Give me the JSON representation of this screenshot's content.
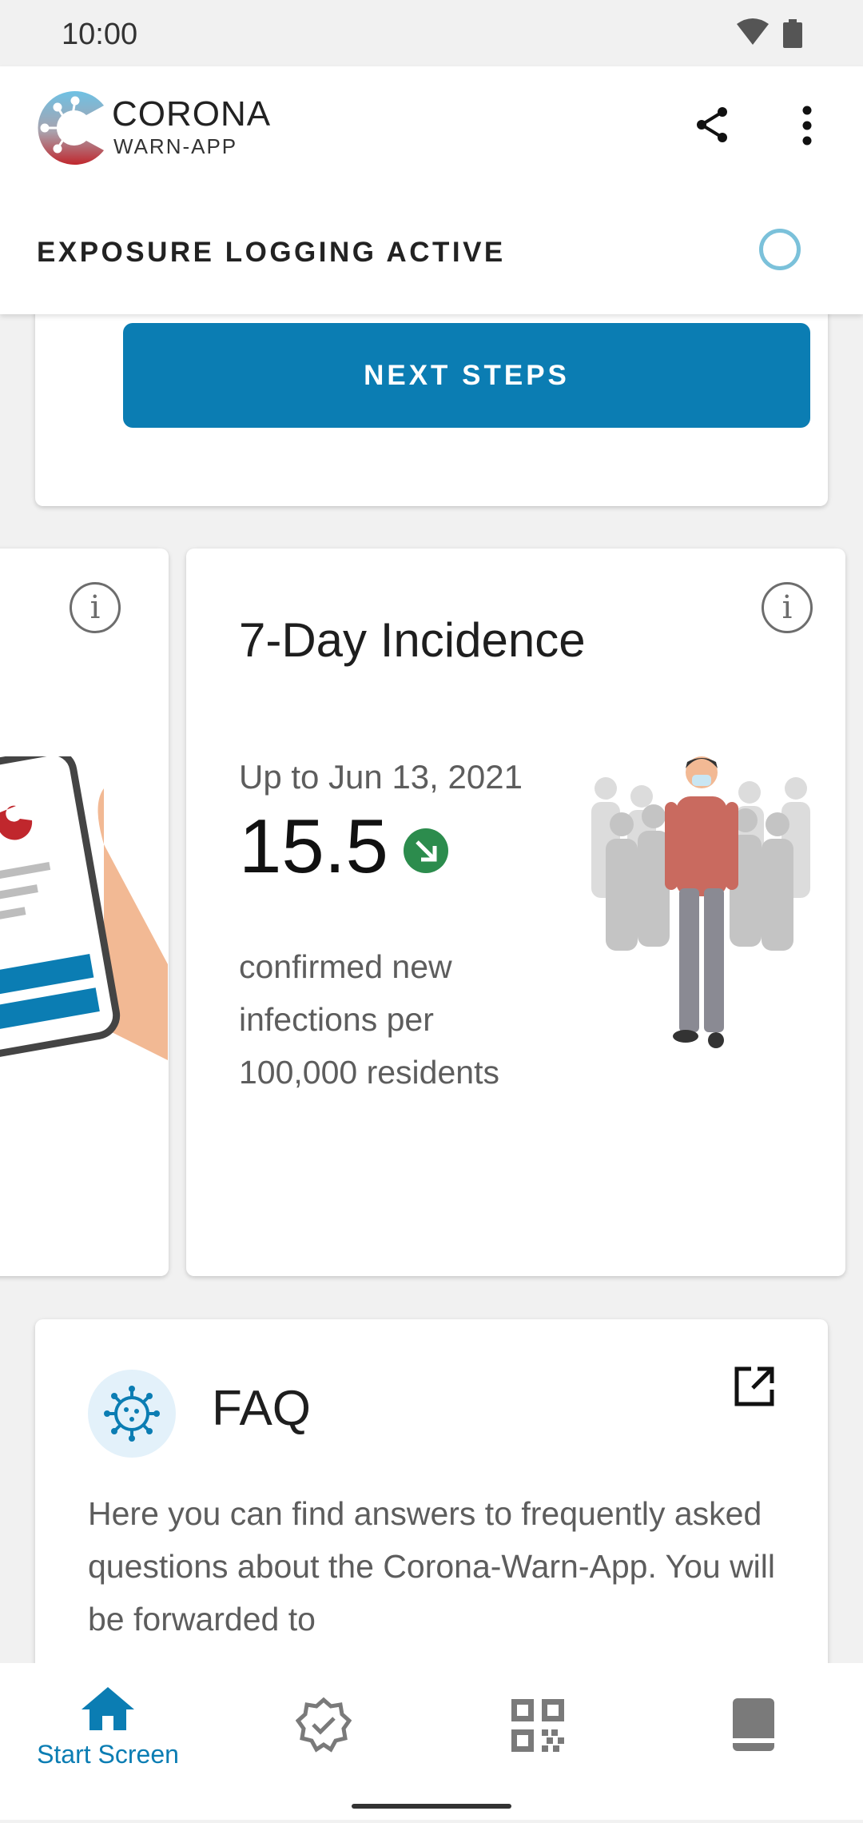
{
  "status_bar": {
    "time": "10:00",
    "icons": [
      "wifi-icon",
      "battery-icon"
    ]
  },
  "header": {
    "logo": "corona-warn-app-logo",
    "brand_line1": "CORONA",
    "brand_line2": "WARN-APP",
    "actions": [
      "share-icon",
      "more-vert-icon"
    ]
  },
  "exposure": {
    "label": "EXPOSURE LOGGING ACTIVE",
    "indicator_color": "#7bc1da"
  },
  "risk_card": {
    "next_steps_label": "NEXT STEPS",
    "button_color": "#0b7db3"
  },
  "incidence_card": {
    "title": "7-Day Incidence",
    "date": "Up to Jun 13, 2021",
    "value": "15.5",
    "trend": "down",
    "trend_color": "#2c8c4d",
    "description": "confirmed new infections per 100,000 residents"
  },
  "faq_card": {
    "title": "FAQ",
    "body": "Here you can find answers to frequently asked questions about the Corona-Warn-App. You will be forwarded to"
  },
  "bottom_nav": {
    "items": [
      {
        "label": "Start Screen",
        "icon": "home-icon",
        "active": true
      },
      {
        "label": "",
        "icon": "certificate-check-icon",
        "active": false
      },
      {
        "label": "",
        "icon": "qr-code-icon",
        "active": false
      },
      {
        "label": "",
        "icon": "diary-book-icon",
        "active": false
      }
    ],
    "active_color": "#0b7db3",
    "inactive_color": "#7a7a7a"
  }
}
